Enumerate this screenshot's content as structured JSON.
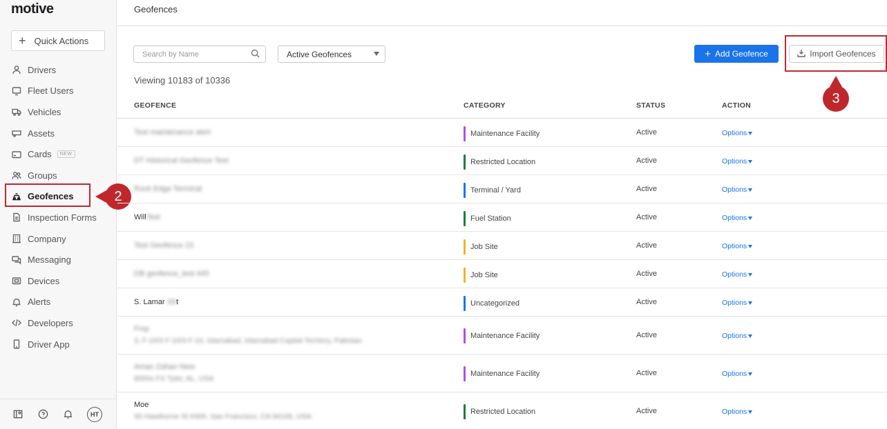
{
  "app": {
    "logo": "motive"
  },
  "sidebar": {
    "quick_actions": "Quick Actions",
    "items": [
      {
        "label": "Drivers",
        "icon": "person-icon"
      },
      {
        "label": "Fleet Users",
        "icon": "monitor-icon"
      },
      {
        "label": "Vehicles",
        "icon": "truck-icon"
      },
      {
        "label": "Assets",
        "icon": "trailer-icon"
      },
      {
        "label": "Cards",
        "icon": "card-icon",
        "badge": "NEW"
      },
      {
        "label": "Groups",
        "icon": "people-icon"
      },
      {
        "label": "Geofences",
        "icon": "geofence-icon",
        "active": true
      },
      {
        "label": "Inspection Forms",
        "icon": "document-icon"
      },
      {
        "label": "Company",
        "icon": "building-icon"
      },
      {
        "label": "Messaging",
        "icon": "chat-icon"
      },
      {
        "label": "Devices",
        "icon": "device-icon"
      },
      {
        "label": "Alerts",
        "icon": "bell-icon"
      },
      {
        "label": "Developers",
        "icon": "code-icon"
      },
      {
        "label": "Driver App",
        "icon": "phone-icon"
      }
    ],
    "footer": {
      "avatar": "HT"
    }
  },
  "callouts": {
    "two": "2",
    "three": "3"
  },
  "header": {
    "title": "Geofences"
  },
  "toolbar": {
    "search_placeholder": "Search by Name",
    "filter_value": "Active Geofences",
    "add_label": "Add Geofence",
    "import_label": "Import Geofences"
  },
  "viewing": "Viewing 10183 of 10336",
  "table": {
    "headers": {
      "geofence": "GEOFENCE",
      "category": "CATEGORY",
      "status": "STATUS",
      "action": "ACTION"
    },
    "rows": [
      {
        "name": "Test maintenance alert",
        "name_blurred": true,
        "category": "Maintenance Facility",
        "color": "#b14fe0",
        "status": "Active",
        "action": "Options"
      },
      {
        "name": "DT Historical Geofence Test",
        "name_blurred": true,
        "category": "Restricted Location",
        "color": "#1e7d3a",
        "status": "Active",
        "action": "Options"
      },
      {
        "name": "Rock Edge Terminal",
        "name_blurred": true,
        "category": "Terminal / Yard",
        "color": "#1a73e8",
        "status": "Active",
        "action": "Options"
      },
      {
        "name": "Will",
        "name_tail": "Test",
        "category": "Fuel Station",
        "color": "#1e7d3a",
        "status": "Active",
        "action": "Options"
      },
      {
        "name": "Test Geofence 23",
        "name_blurred": true,
        "category": "Job Site",
        "color": "#f0b323",
        "status": "Active",
        "action": "Options"
      },
      {
        "name": "DB geofence_test 445",
        "name_blurred": true,
        "category": "Job Site",
        "color": "#f0b323",
        "status": "Active",
        "action": "Options"
      },
      {
        "name": "S. Lamar",
        "name_tail": "Stt",
        "name_end": "t",
        "category": "Uncategorized",
        "color": "#1a73e8",
        "status": "Active",
        "action": "Options"
      },
      {
        "name": "Fmp",
        "name_blurred": true,
        "address": "3, F-10/3 F-10/3 F-10, Islamabad, Islamabad Capital Territory, Pakistan",
        "category": "Maintenance Facility",
        "color": "#b14fe0",
        "status": "Active",
        "action": "Options"
      },
      {
        "name": "Aman Zahan New",
        "name_blurred": true,
        "address": "8000s FX Tyler, AL, USA",
        "category": "Maintenance Facility",
        "color": "#b14fe0",
        "status": "Active",
        "action": "Options"
      },
      {
        "name": "Moe",
        "address": "55 Hawthorne St #400, San Francisco, CA 94105, USA",
        "category": "Restricted Location",
        "color": "#1e7d3a",
        "status": "Active",
        "action": "Options"
      }
    ]
  }
}
